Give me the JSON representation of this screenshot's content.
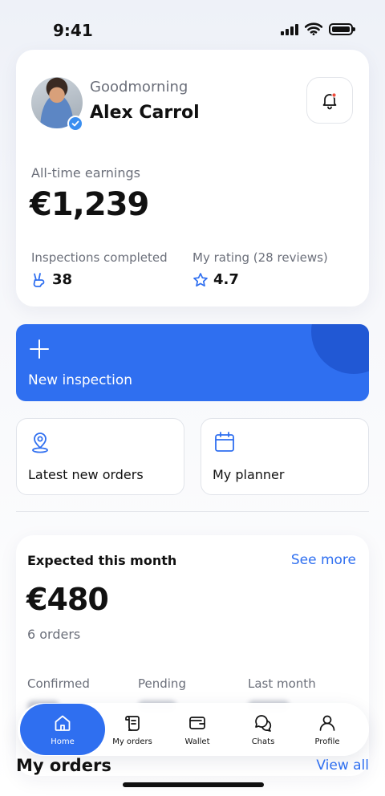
{
  "status_bar": {
    "time": "9:41"
  },
  "header": {
    "greeting": "Goodmorning",
    "user_name": "Alex Carrol",
    "earnings_label": "All-time earnings",
    "earnings_value": "€1,239",
    "inspections_label": "Inspections completed",
    "inspections_value": "38",
    "rating_label": "My rating (28 reviews)",
    "rating_value": "4.7"
  },
  "actions": {
    "new_inspection": "New inspection",
    "latest_orders": "Latest new orders",
    "planner": "My planner"
  },
  "expected": {
    "title": "Expected this month",
    "see_more": "See more",
    "amount": "€480",
    "orders": "6 orders",
    "columns": [
      "Confirmed",
      "Pending",
      "Last month"
    ]
  },
  "nav": {
    "items": [
      {
        "label": "Home",
        "icon": "home-icon",
        "active": true
      },
      {
        "label": "My orders",
        "icon": "scroll-icon"
      },
      {
        "label": "Wallet",
        "icon": "wallet-icon"
      },
      {
        "label": "Chats",
        "icon": "chat-icon"
      },
      {
        "label": "Profile",
        "icon": "user-icon"
      }
    ]
  },
  "orders_section": {
    "title": "My orders",
    "view_all": "View all"
  },
  "colors": {
    "accent": "#2f6ff0",
    "accent_dark": "#2158d4",
    "muted": "#6b6f7a"
  }
}
